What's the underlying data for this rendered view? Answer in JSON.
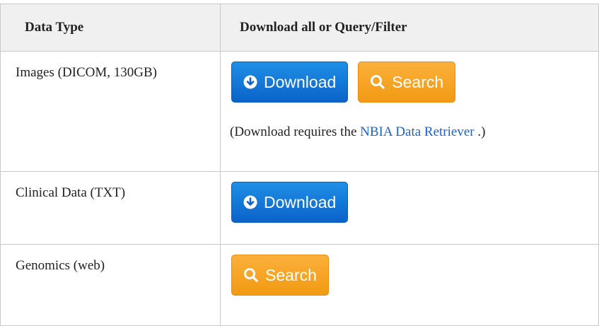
{
  "table": {
    "headers": {
      "type": "Data Type",
      "actions": "Download all or Query/Filter"
    },
    "rows": [
      {
        "type": "Images (DICOM, 130GB)",
        "download_label": "Download",
        "search_label": "Search",
        "note_prefix": "(Download requires the ",
        "note_link": "NBIA Data Retriever",
        "note_suffix": " .)"
      },
      {
        "type": "Clinical Data (TXT)",
        "download_label": "Download"
      },
      {
        "type": "Genomics (web)",
        "search_label": "Search"
      }
    ]
  },
  "colors": {
    "download_button": "#0b63c9",
    "search_button": "#f29a13",
    "link": "#1a63c9",
    "header_bg": "#f0f0f0"
  },
  "icons": {
    "download": "circle-arrow-down-icon",
    "search": "magnifier-icon"
  }
}
